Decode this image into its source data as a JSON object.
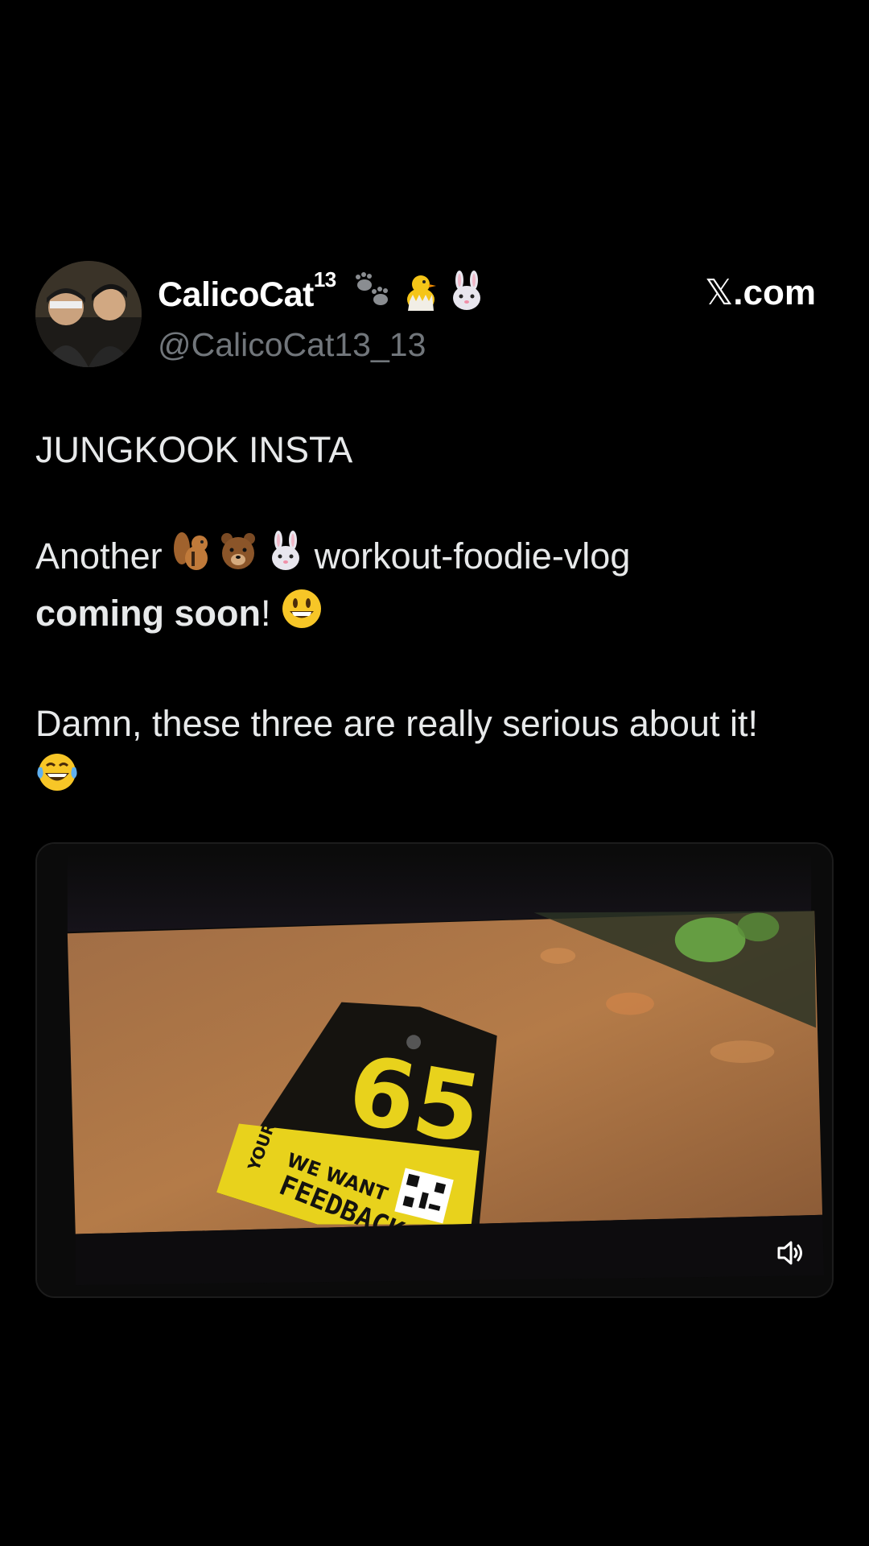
{
  "author": {
    "display_name": "CalicoCat",
    "name_superscript": "13",
    "name_emojis": [
      "paw-prints-icon",
      "hatching-chick-icon",
      "rabbit-face-icon"
    ],
    "handle": "@CalicoCat13_13"
  },
  "brand": {
    "x_glyph": "𝕏",
    "suffix": ".com"
  },
  "tweet": {
    "line1": "JUNGKOOK INSTA",
    "line2_start": "Another",
    "line2_emojis": [
      "chipmunk-icon",
      "bear-face-icon",
      "rabbit-face-icon"
    ],
    "line2_end": "workout-foodie-vlog",
    "line3_bold": "coming soon",
    "line3_rest": "!",
    "line3_emoji": "grinning-face-icon",
    "line4": "Damn, these three are really serious about it!",
    "line5_emoji": "tears-of-joy-icon"
  },
  "media": {
    "tag_number": "65",
    "tag_line1": "WE WANT",
    "tag_line2": "FEEDBACK",
    "tag_side": "YOUR",
    "volume_icon": "speaker-icon"
  },
  "colors": {
    "background": "#000000",
    "handle": "#71767b",
    "text": "#e7e9ea",
    "tag_yellow": "#e8d21c"
  }
}
